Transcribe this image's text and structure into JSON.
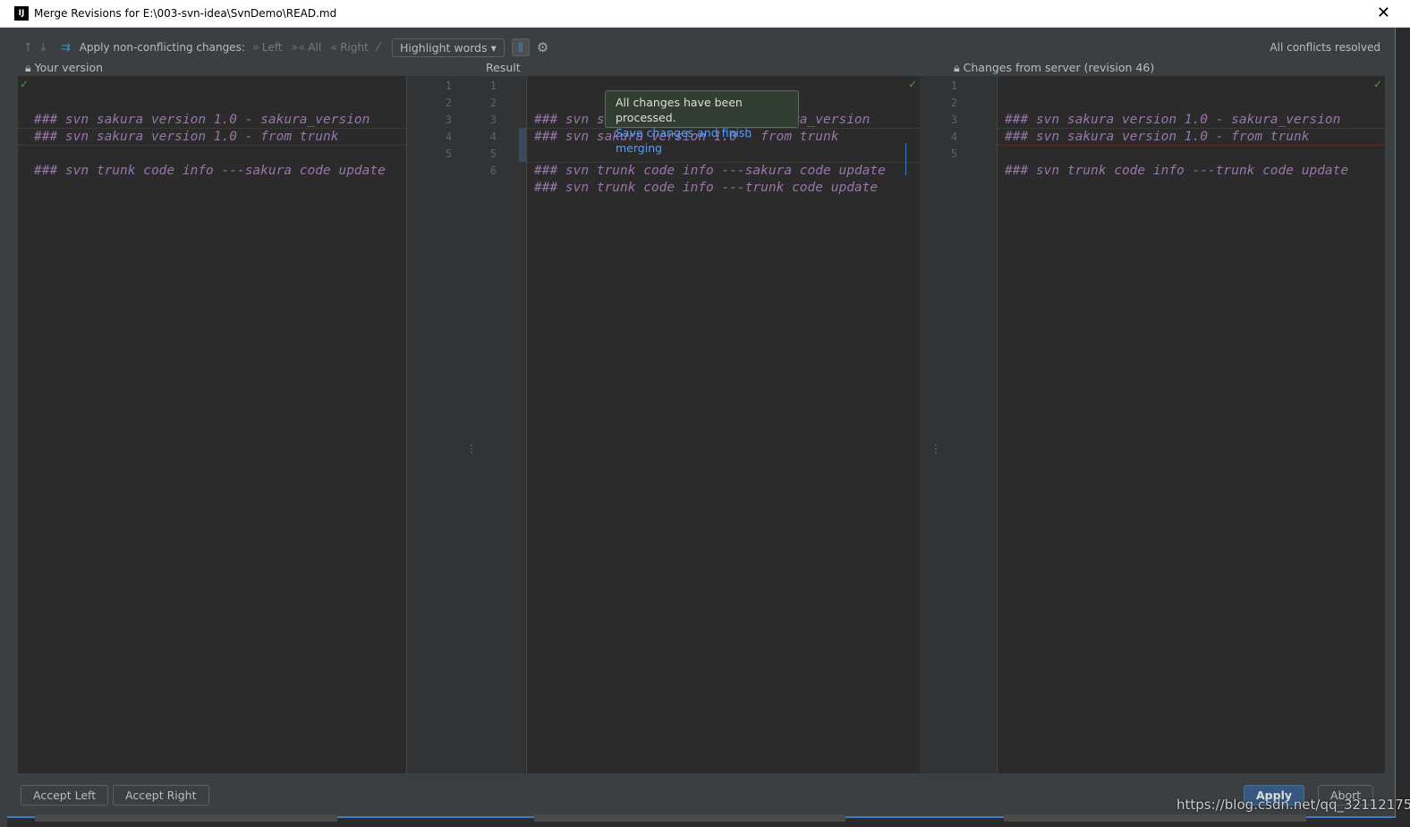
{
  "window": {
    "title": "Merge Revisions for E:\\003-svn-idea\\SvnDemo\\READ.md",
    "close": "✕"
  },
  "toolbar": {
    "apply_label": "Apply non-conflicting changes:",
    "left": "Left",
    "all": "All",
    "right": "Right",
    "highlight": "Highlight words",
    "status": "All conflicts resolved"
  },
  "panels": {
    "left_title": "Your version",
    "center_title": "Result",
    "right_title": "Changes from server (revision 46)"
  },
  "left_lines": [
    "### svn sakura version 1.0 - sakura_version",
    "### svn sakura version 1.0 - from trunk",
    "",
    "### svn trunk code info ---sakura code update"
  ],
  "center_lines": [
    "### svn sakura version 1.0 - sakura_version",
    "### svn sakura version 1.0 - from trunk",
    "",
    "### svn trunk code info ---sakura code update",
    "### svn trunk code info ---trunk code update"
  ],
  "right_lines": [
    "### svn sakura version 1.0 - sakura_version",
    "### svn sakura version 1.0 - from trunk",
    "",
    "### svn trunk code info ---trunk code update"
  ],
  "gutter_left": [
    "1",
    "2",
    "3",
    "4",
    "5"
  ],
  "gutter_center": [
    "1",
    "2",
    "3",
    "4",
    "5",
    "6"
  ],
  "gutter_right": [
    "1",
    "2",
    "3",
    "4",
    "5"
  ],
  "tooltip": {
    "text": "All changes have been processed.",
    "link": "Save changes and finish merging"
  },
  "buttons": {
    "accept_left": "Accept Left",
    "accept_right": "Accept Right",
    "apply": "Apply",
    "abort": "Abort"
  },
  "watermark": "https://blog.csdn.net/qq_32112175",
  "colors": {
    "accent": "#365880",
    "code": "#9876aa",
    "link": "#589df6"
  }
}
